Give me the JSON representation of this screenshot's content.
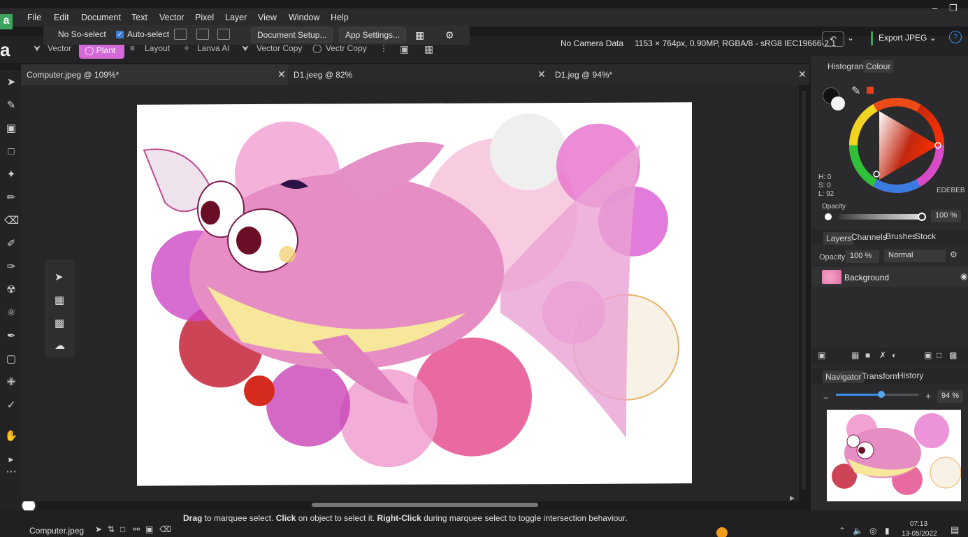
{
  "app": {
    "logo": "a"
  },
  "menu": [
    "File",
    "Edit",
    "Document",
    "Text",
    "Vector",
    "Pixel",
    "Layer",
    "View",
    "Window",
    "Help"
  ],
  "context_toolbar": {
    "no_select": "No So-select",
    "auto_select": "Auto-select",
    "document_setup": "Document Setup...",
    "app_settings": "App Settings..."
  },
  "personas": {
    "vector": "Vector",
    "paint": "Plant",
    "layout": "Layout",
    "canva_ai": "Lanva AI",
    "vector_copy": "Vector Copy",
    "vectr_copy": "Vectr Copy"
  },
  "info": {
    "camera": "No Camera Data",
    "doc_info": "1153 × 764px, 0.90MP, RGBA/8 - sRG8 IEC19666-2.1",
    "export": "Export JPEG"
  },
  "tabs": [
    {
      "label": "Computer.jpeg @ 109%*"
    },
    {
      "label": "D1.jeeg @ 82%"
    },
    {
      "label": "D1.jeg @ 94%*"
    }
  ],
  "colour_panel": {
    "tab_histogram": "Histogram",
    "tab_colour": "Colour",
    "h": "H: 0",
    "s": "S: 0",
    "l": "L: 92",
    "hex": "EDEBEB",
    "opacity_label": "Opacity",
    "opacity_value": "100 %"
  },
  "layers_panel": {
    "tabs": [
      "Layers",
      "Channels",
      "Brushes",
      "Stock"
    ],
    "opacity_label": "Opacity:",
    "opacity_value": "100 %",
    "blend_mode": "Normal",
    "layer_name": "Background"
  },
  "navigator_panel": {
    "tabs": [
      "Navigator",
      "Transform",
      "History"
    ],
    "zoom": "94 %",
    "minus": "−",
    "plus": "+",
    "zoom_fraction": 0.55
  },
  "status": {
    "file": "Computer.jpeg",
    "hint_bold1": "Drag",
    "hint1": " to marquee select. ",
    "hint_bold2": "Click",
    "hint2": " on object to select it. ",
    "hint_bold3": "Right-Click",
    "hint3": " during marquee select to toggle intersection behaviour."
  },
  "taskbar": {
    "time": "07:13",
    "date": "13-05/2022"
  }
}
